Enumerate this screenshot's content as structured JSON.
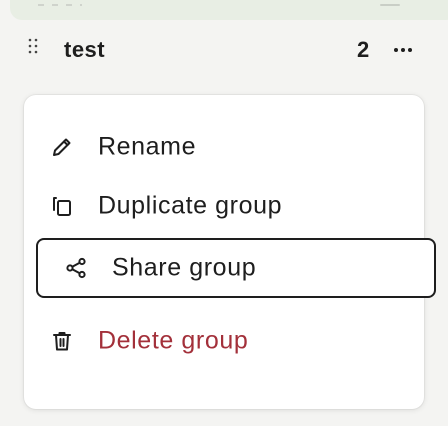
{
  "group": {
    "name": "test",
    "count": "2",
    "drag_icon": "drag-handle-icon",
    "more_icon": "more-horizontal-icon"
  },
  "menu": {
    "items": [
      {
        "label": "Rename",
        "icon": "pencil-icon"
      },
      {
        "label": "Duplicate group",
        "icon": "duplicate-icon"
      },
      {
        "label": "Share group",
        "icon": "share-icon"
      },
      {
        "label": "Delete group",
        "icon": "trash-icon"
      }
    ]
  },
  "colors": {
    "text": "#1e1e1e",
    "danger": "#a3303a",
    "focus_border": "#1e1e1e",
    "menu_bg": "#ffffff",
    "page_bg": "#f4f4f2",
    "card_bg": "#e8eee4"
  }
}
